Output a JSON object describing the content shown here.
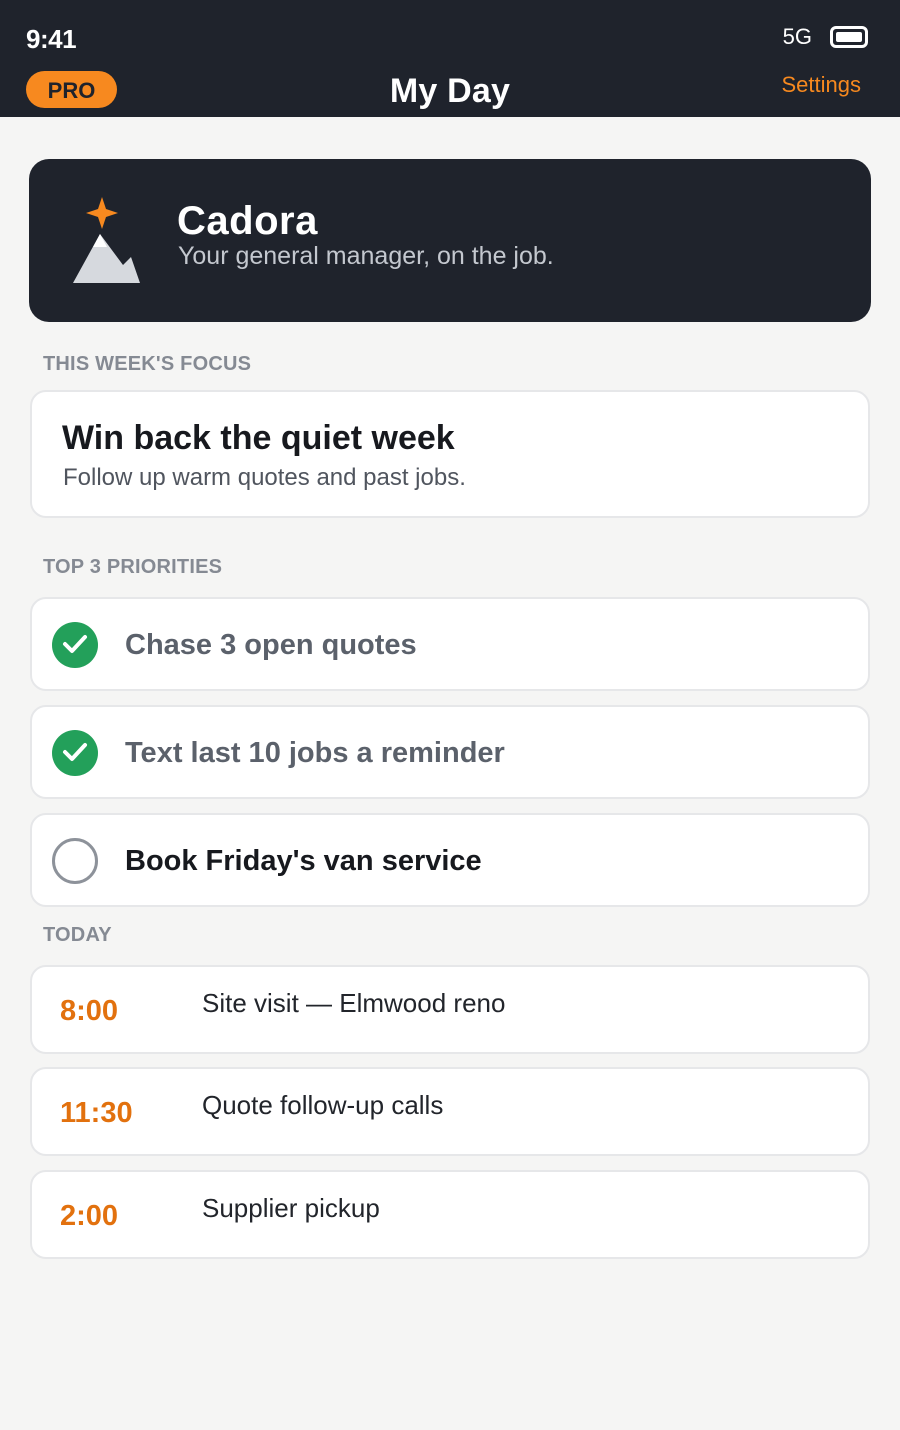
{
  "status_bar": {
    "time": "9:41",
    "network": "5G"
  },
  "header": {
    "badge": "PRO",
    "title": "My Day",
    "settings_label": "Settings"
  },
  "hero": {
    "name": "Cadora",
    "tagline": "Your general manager, on the job."
  },
  "focus": {
    "section_label": "THIS WEEK'S FOCUS",
    "title": "Win back the quiet week",
    "subtitle": "Follow up warm quotes and past jobs."
  },
  "priorities": {
    "section_label": "TOP 3 PRIORITIES",
    "items": [
      {
        "label": "Chase 3 open quotes",
        "done": true
      },
      {
        "label": "Text last 10 jobs a reminder",
        "done": true
      },
      {
        "label": "Book Friday's van service",
        "done": false
      }
    ]
  },
  "today": {
    "section_label": "TODAY",
    "events": [
      {
        "time": "8:00",
        "title": "Site visit — Elmwood reno"
      },
      {
        "time": "11:30",
        "title": "Quote follow-up calls"
      },
      {
        "time": "2:00",
        "title": "Supplier pickup"
      }
    ]
  },
  "colors": {
    "header_bg": "#1f232c",
    "accent_orange": "#f7891f",
    "time_orange": "#e2710e",
    "check_green": "#23a05a",
    "page_bg": "#f5f5f4"
  },
  "icons": {
    "logo": "mountain-star-icon",
    "check_done": "checkmark-icon",
    "check_todo": "empty-circle-icon",
    "battery": "battery-icon"
  }
}
